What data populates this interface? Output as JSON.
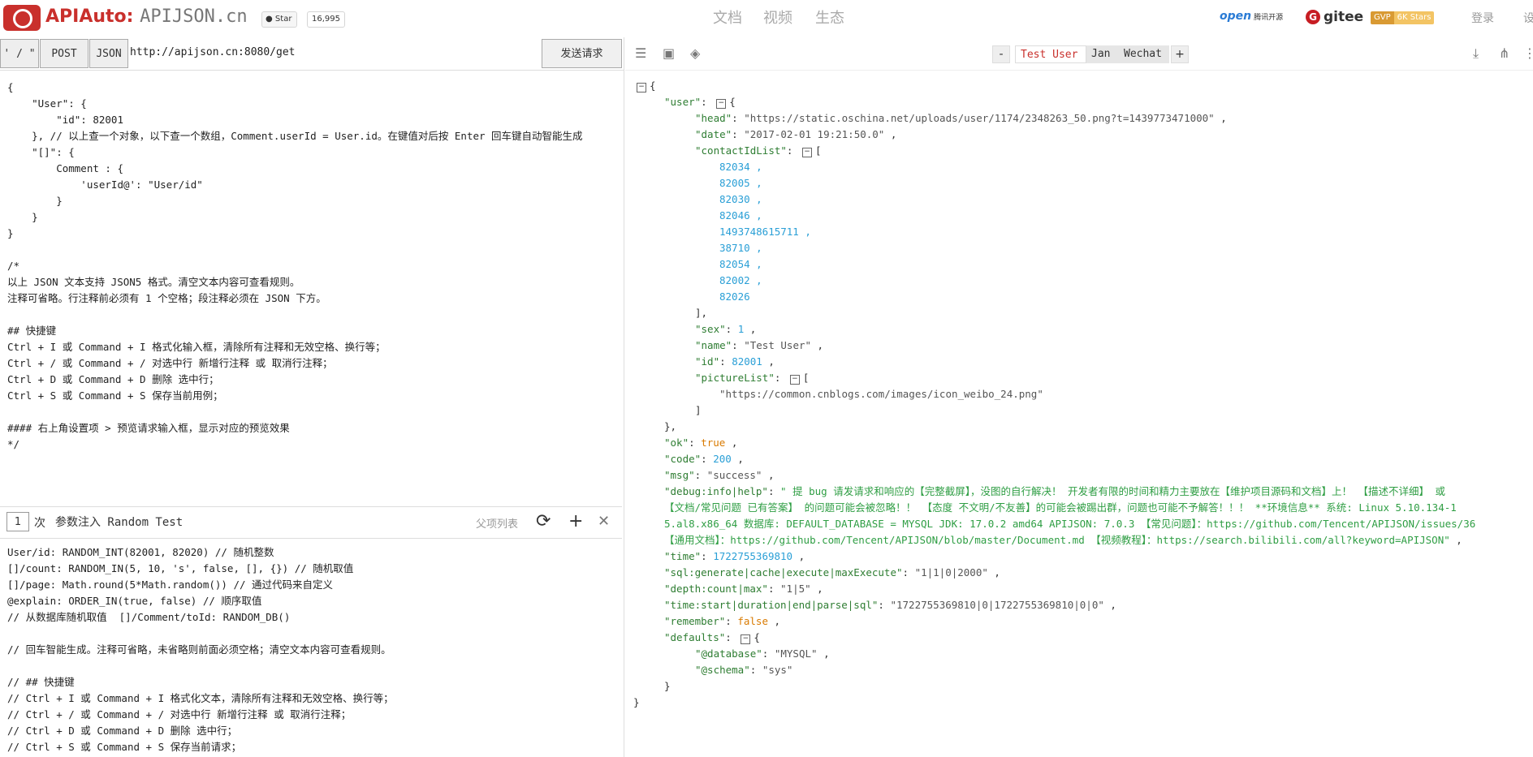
{
  "header": {
    "brand": "APIAuto:",
    "site": "APIJSON.cn",
    "github_star_label": "Star",
    "github_star_count": "16,995",
    "nav": [
      "文档",
      "视频",
      "生态"
    ],
    "partner_open": "open",
    "partner_open_sub": "腾讯开源",
    "gitee": "gitee",
    "gvp_a": "GVP",
    "gvp_b": "6K Stars",
    "login": "登录",
    "settings": "设"
  },
  "request": {
    "method_quote_btn": "' / \"",
    "method_btn": "POST",
    "type_btn": "JSON",
    "url": "http://apijson.cn:8080/get",
    "send_btn": "发送请求"
  },
  "editor_lines": [
    "{",
    "    \"User\": {",
    "        \"id\": 82001",
    "    }, // 以上查一个对象，以下查一个数组，Comment.userId = User.id。在键值对后按 Enter 回车键自动智能生成",
    "    \"[]\": {",
    "        Comment : {",
    "            'userId@': \"User/id\"",
    "        }",
    "    }",
    "}",
    "",
    "/*",
    "以上 JSON 文本支持 JSON5 格式。清空文本内容可查看规则。",
    "注释可省略。行注释前必须有 1 个空格；段注释必须在 JSON 下方。",
    "",
    "## 快捷键",
    "Ctrl + I 或 Command + I 格式化输入框，清除所有注释和无效空格、换行等；",
    "Ctrl + / 或 Command + / 对选中行 新增行注释 或 取消行注释；",
    "Ctrl + D 或 Command + D 删除 选中行；",
    "Ctrl + S 或 Command + S 保存当前用例；",
    "",
    "#### 右上角设置项 > 预览请求输入框，显示对应的预览效果",
    "*/"
  ],
  "random": {
    "count": "1",
    "ci": "次",
    "title": "参数注入 Random Test",
    "parent": "父项列表",
    "refresh_icon": "refresh-icon",
    "add_icon": "plus-icon",
    "close_icon": "close-icon",
    "lines": [
      "User/id: RANDOM_INT(82001, 82020) // 随机整数",
      "[]/count: RANDOM_IN(5, 10, 's', false, [], {}) // 随机取值",
      "[]/page: Math.round(5*Math.random()) // 通过代码来自定义",
      "@explain: ORDER_IN(true, false) // 顺序取值",
      "// 从数据库随机取值  []/Comment/toId: RANDOM_DB()",
      "",
      "// 回车智能生成。注释可省略，未省略则前面必须空格；清空文本内容可查看规则。",
      "",
      "// ## 快捷键",
      "// Ctrl + I 或 Command + I 格式化文本，清除所有注释和无效空格、换行等；",
      "// Ctrl + / 或 Command + / 对选中行 新增行注释 或 取消行注释；",
      "// Ctrl + D 或 Command + D 删除 选中行；",
      "// Ctrl + S 或 Command + S 保存当前请求；"
    ]
  },
  "accounts": {
    "minus": "-",
    "plus": "+",
    "items": [
      "Test User",
      "Jan",
      "Wechat"
    ]
  },
  "response": {
    "user_key": "user",
    "head_key": "head",
    "head_val": "\"https://static.oschina.net/uploads/user/1174/2348263_50.png?t=1439773471000\"",
    "date_key": "date",
    "date_val": "\"2017-02-01 19:21:50.0\"",
    "contact_key": "contactIdList",
    "contact_ids": [
      "82034",
      "82005",
      "82030",
      "82046",
      "1493748615711",
      "38710",
      "82054",
      "82002",
      "82026"
    ],
    "sex_key": "sex",
    "sex_val": "1",
    "name_key": "name",
    "name_val": "\"Test User\"",
    "id_key": "id",
    "id_val": "82001",
    "picture_key": "pictureList",
    "picture_val": "\"https://common.cnblogs.com/images/icon_weibo_24.png\"",
    "ok_key": "ok",
    "ok_val": "true",
    "code_key": "code",
    "code_val": "200",
    "msg_key": "msg",
    "msg_val": "\"success\"",
    "debug_key": "debug:info|help",
    "debug_line1": "\" 提 bug 请发请求和响应的【完整截屏】，没图的自行解决！ 开发者有限的时间和精力主要放在【维护项目源码和文档】上！ 【描述不详细】 或",
    "debug_line2": "【文档/常见问题 已有答案】 的问题可能会被忽略！！ 【态度 不文明/不友善】的可能会被踢出群，问题也可能不予解答！！！ **环境信息** 系统: Linux 5.10.134-1",
    "debug_line3": "5.al8.x86_64 数据库: DEFAULT_DATABASE = MYSQL JDK: 17.0.2 amd64 APIJSON: 7.0.3 【常见问题】：https://github.com/Tencent/APIJSON/issues/36",
    "debug_line4": "【通用文档】：https://github.com/Tencent/APIJSON/blob/master/Document.md 【视频教程】：https://search.bilibili.com/all?keyword=APIJSON\"",
    "time_key": "time",
    "time_val": "1722755369810",
    "sql_key": "sql:generate|cache|execute|maxExecute",
    "sql_val": "\"1|1|0|2000\"",
    "depth_key": "depth:count|max",
    "depth_val": "\"1|5\"",
    "timing_key": "time:start|duration|end|parse|sql",
    "timing_val": "\"1722755369810|0|1722755369810|0|0\"",
    "remember_key": "remember",
    "remember_val": "false",
    "defaults_key": "defaults",
    "database_key": "@database",
    "database_val": "\"MYSQL\"",
    "schema_key": "@schema",
    "schema_val": "\"sys\""
  }
}
